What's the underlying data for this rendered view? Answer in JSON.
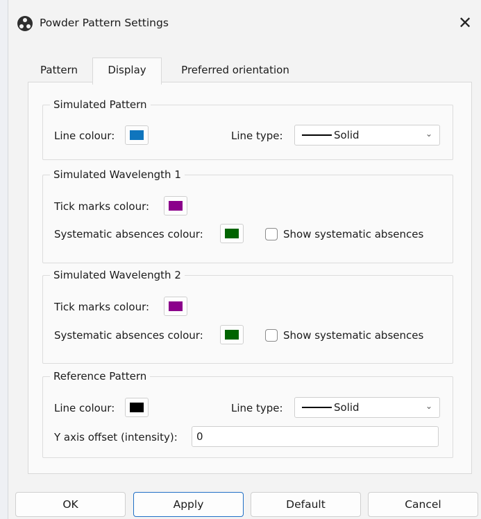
{
  "window": {
    "title": "Powder Pattern Settings",
    "close_glyph": "✕"
  },
  "tabs": [
    {
      "label": "Pattern"
    },
    {
      "label": "Display"
    },
    {
      "label": "Preferred orientation"
    }
  ],
  "selected_tab": "Display",
  "groups": {
    "simulated_pattern": {
      "title": "Simulated Pattern",
      "line_colour_label": "Line colour:",
      "line_colour": "#0f75bd",
      "line_type_label": "Line type:",
      "line_type_value": "Solid"
    },
    "wavelength1": {
      "title": "Simulated Wavelength 1",
      "tick_label": "Tick marks colour:",
      "tick_colour": "#8b008b",
      "absences_label": "Systematic absences colour:",
      "absences_colour": "#006400",
      "show_absences_label": "Show systematic absences",
      "show_absences_checked": false
    },
    "wavelength2": {
      "title": "Simulated Wavelength 2",
      "tick_label": "Tick marks colour:",
      "tick_colour": "#8b008b",
      "absences_label": "Systematic absences colour:",
      "absences_colour": "#006400",
      "show_absences_label": "Show systematic absences",
      "show_absences_checked": false
    },
    "reference_pattern": {
      "title": "Reference Pattern",
      "line_colour_label": "Line colour:",
      "line_colour": "#000000",
      "line_type_label": "Line type:",
      "line_type_value": "Solid",
      "y_offset_label": "Y axis offset (intensity):",
      "y_offset_value": "0"
    }
  },
  "buttons": {
    "ok": "OK",
    "apply": "Apply",
    "default": "Default",
    "cancel": "Cancel"
  }
}
